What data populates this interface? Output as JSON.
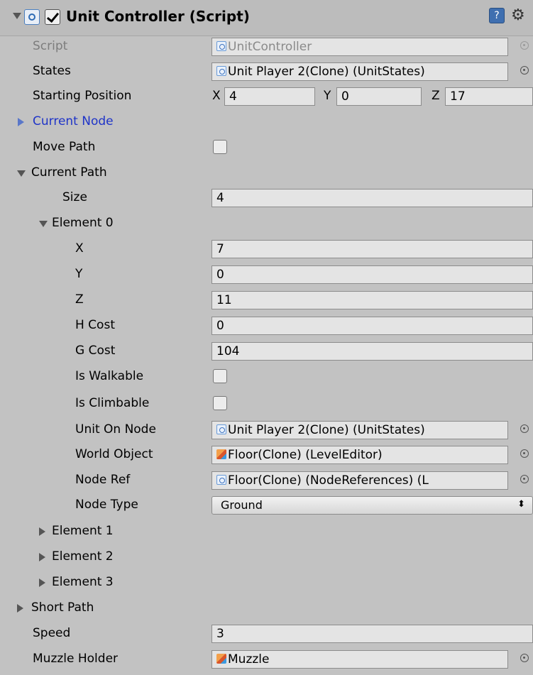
{
  "header": {
    "title": "Unit Controller (Script)",
    "help_icon": "help-icon",
    "gear_icon": "gear-icon"
  },
  "script_row": {
    "label": "Script",
    "value": "UnitController"
  },
  "states_row": {
    "label": "States",
    "value": "Unit Player 2(Clone) (UnitStates)"
  },
  "starting_position": {
    "label": "Starting Position",
    "x_label": "X",
    "x": "4",
    "y_label": "Y",
    "y": "0",
    "z_label": "Z",
    "z": "17"
  },
  "current_node": {
    "label": "Current Node"
  },
  "move_path": {
    "label": "Move Path",
    "checked": false
  },
  "current_path": {
    "label": "Current Path",
    "size_label": "Size",
    "size": "4",
    "element0": {
      "label": "Element 0",
      "x_label": "X",
      "x": "7",
      "y_label": "Y",
      "y": "0",
      "z_label": "Z",
      "z": "11",
      "h_cost_label": "H Cost",
      "h_cost": "0",
      "g_cost_label": "G Cost",
      "g_cost": "104",
      "is_walkable_label": "Is Walkable",
      "is_climbable_label": "Is Climbable",
      "unit_on_node_label": "Unit On Node",
      "unit_on_node": "Unit Player 2(Clone) (UnitStates)",
      "world_object_label": "World Object",
      "world_object": "Floor(Clone) (LevelEditor)",
      "node_ref_label": "Node Ref",
      "node_ref": "Floor(Clone) (NodeReferences) (L",
      "node_type_label": "Node Type",
      "node_type": "Ground"
    },
    "element1": "Element 1",
    "element2": "Element 2",
    "element3": "Element 3"
  },
  "short_path": {
    "label": "Short Path"
  },
  "speed": {
    "label": "Speed",
    "value": "3"
  },
  "muzzle_holder": {
    "label": "Muzzle Holder",
    "value": "Muzzle"
  },
  "colors": {
    "panel_bg": "#c2c2c2",
    "field_bg": "#e4e4e4",
    "link_blue": "#1f34c8",
    "dim_text": "#7d7d7d"
  }
}
